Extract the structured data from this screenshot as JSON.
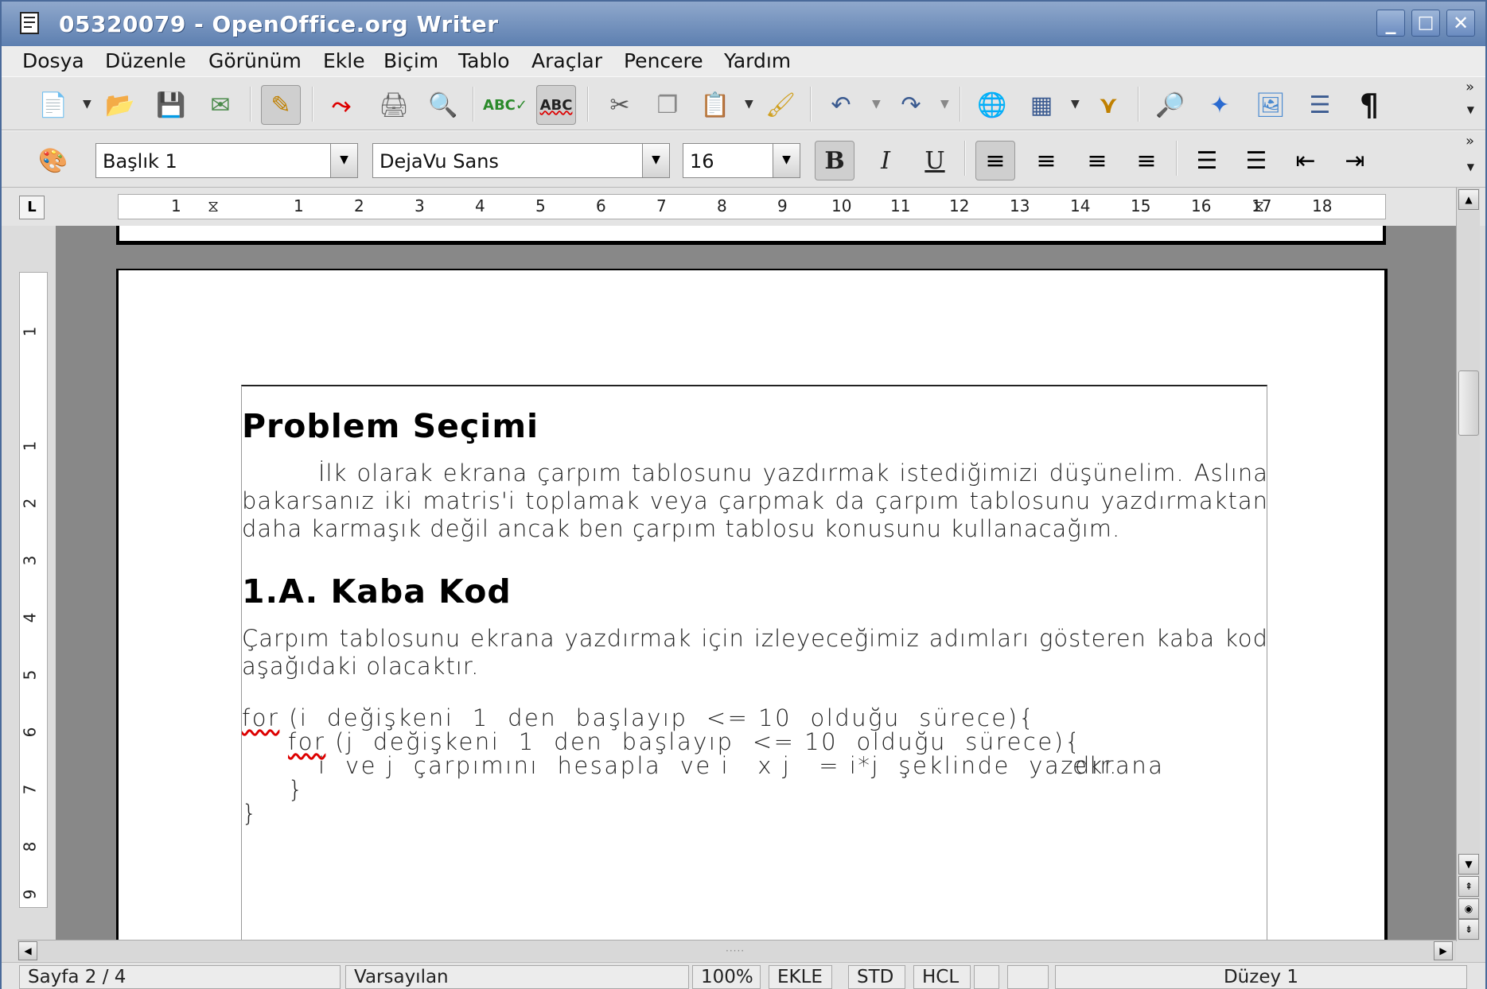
{
  "window": {
    "title": "05320079 - OpenOffice.org Writer",
    "controls": {
      "minimize": "_",
      "maximize": "□",
      "close": "✕"
    }
  },
  "menu": [
    {
      "label": "Dosya",
      "name": "menu-dosya"
    },
    {
      "label": "Düzenle",
      "name": "menu-duzenle"
    },
    {
      "label": "Görünüm",
      "name": "menu-gorunum"
    },
    {
      "label": "Ekle",
      "name": "menu-ekle"
    },
    {
      "label": "Biçim",
      "name": "menu-bicim"
    },
    {
      "label": "Tablo",
      "name": "menu-tablo"
    },
    {
      "label": "Araçlar",
      "name": "menu-araclar"
    },
    {
      "label": "Pencere",
      "name": "menu-pencere"
    },
    {
      "label": "Yardım",
      "name": "menu-yardim"
    }
  ],
  "toolbar": {
    "overflow": "»",
    "icons": {
      "new": "📄",
      "open": "📂",
      "save": "💾",
      "email": "✉",
      "edit_file": "✎",
      "export_pdf": "⤳",
      "print": "🖨",
      "preview": "🔍",
      "spellcheck": "ABC✓",
      "autospell": "ABC",
      "cut": "✂",
      "copy": "❐",
      "paste": "📋",
      "clone": "🖌",
      "undo": "↶",
      "redo": "↷",
      "hyperlink": "🌐",
      "table": "▦",
      "show_draw": "⋎",
      "find": "🔎",
      "navigator": "✦",
      "gallery": "🖼",
      "datasources": "☰",
      "formatting_marks": "¶"
    }
  },
  "format_toolbar": {
    "styles_icon": "🎨",
    "paragraph_style": "Başlık 1",
    "font_name": "DejaVu Sans",
    "font_size": "16",
    "bold": "B",
    "italic": "I",
    "underline": "U",
    "icons": {
      "align_left": "≡",
      "align_center": "≡",
      "align_right": "≡",
      "justify": "≡",
      "numbering": "☰",
      "bullets": "☰",
      "decrease_indent": "⇤",
      "increase_indent": "⇥"
    }
  },
  "ruler": {
    "corner": "L",
    "marks": [
      "1",
      "1",
      "2",
      "3",
      "4",
      "5",
      "6",
      "7",
      "8",
      "9",
      "10",
      "11",
      "12",
      "13",
      "14",
      "15",
      "16",
      "17",
      "18"
    ],
    "vertical_marks": [
      "1",
      "1",
      "2",
      "3",
      "4",
      "5",
      "6",
      "7",
      "8",
      "9"
    ]
  },
  "document": {
    "heading1": "Problem Seçimi",
    "para1": "İlk olarak ekrana çarpım tablosunu yazdırmak istediğimizi düşünelim. Aslına bakarsanız iki matris'i toplamak veya çarpmak da çarpım tablosunu yazdırmaktan daha karmaşık değil ancak ben çarpım tablosu konusunu kullanacağım.",
    "heading2": "1.A. Kaba Kod",
    "para2": "Çarpım tablosunu ekrana yazdırmak için izleyeceğimiz adımları gösteren kaba kod aşağıdaki olacaktır.",
    "code": {
      "line1_kw": "for",
      "line1_rest": " (i  değişkeni  1  den  başlayıp  <= 10  olduğu  sürece){",
      "line2_kw": "for",
      "line2_rest": " (j  değişkeni  1  den  başlayıp  <= 10  olduğu  sürece){",
      "line3": "i  ve j  çarpımını  hesapla  ve i   x j   = i*j  şeklinde  yazdır.",
      "line3_overlap": "ekrana",
      "line4": "}",
      "line5": "}"
    }
  },
  "scrollbars": {
    "up": "▲",
    "down": "▼",
    "left": "◀",
    "right": "▶",
    "grip": "·····"
  },
  "status": {
    "page": "Sayfa 2 / 4",
    "style": "Varsayılan",
    "zoom": "100%",
    "insert_mode": "EKLE",
    "selection_mode": "STD",
    "hyperlink_mode": "HCL",
    "level": "Düzey 1"
  }
}
